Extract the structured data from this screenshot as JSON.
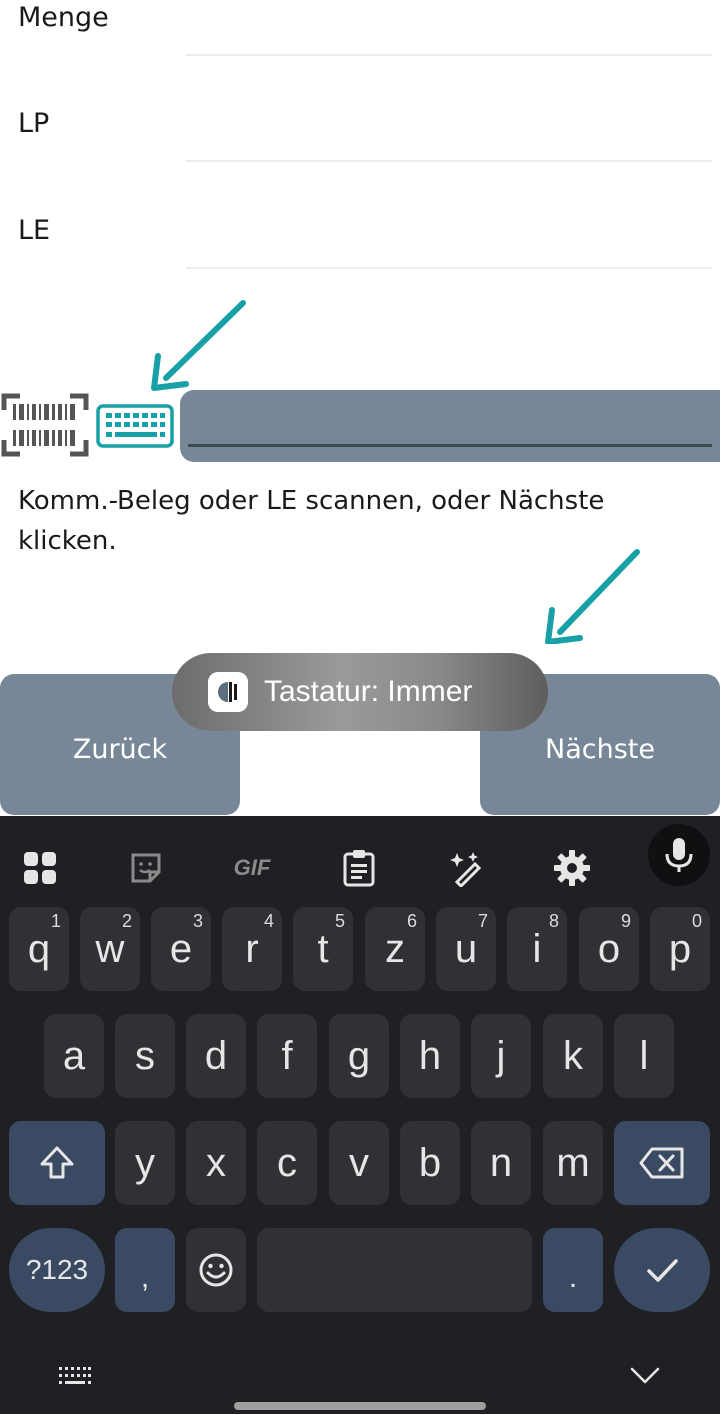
{
  "form": {
    "fields": [
      {
        "label": "Menge",
        "value": ""
      },
      {
        "label": "LP",
        "value": ""
      },
      {
        "label": "LE",
        "value": ""
      }
    ],
    "scan_input_value": "",
    "hint": "Komm.-Beleg oder LE scannen, oder Nächste klicken."
  },
  "buttons": {
    "back": "Zurück",
    "next": "Nächste"
  },
  "toast": {
    "text": "Tastatur: Immer"
  },
  "keyboard": {
    "toolbar": [
      "apps-grid-icon",
      "sticker-icon",
      "gif-icon",
      "clipboard-icon",
      "magic-edit-icon",
      "settings-icon",
      "microphone-icon"
    ],
    "gif_label": "GIF",
    "row1": [
      {
        "key": "q",
        "hint": "1"
      },
      {
        "key": "w",
        "hint": "2"
      },
      {
        "key": "e",
        "hint": "3"
      },
      {
        "key": "r",
        "hint": "4"
      },
      {
        "key": "t",
        "hint": "5"
      },
      {
        "key": "z",
        "hint": "6"
      },
      {
        "key": "u",
        "hint": "7"
      },
      {
        "key": "i",
        "hint": "8"
      },
      {
        "key": "o",
        "hint": "9"
      },
      {
        "key": "p",
        "hint": "0"
      }
    ],
    "row2": [
      "a",
      "s",
      "d",
      "f",
      "g",
      "h",
      "j",
      "k",
      "l"
    ],
    "row3": [
      "y",
      "x",
      "c",
      "v",
      "b",
      "n",
      "m"
    ],
    "symbols_label": "?123",
    "comma": ",",
    "period": "."
  },
  "colors": {
    "accent_teal": "#17a0a6",
    "button_gray": "#788797",
    "keyboard_bg": "#1e2023",
    "key_bg": "#2f3134",
    "fn_key_bg": "#3a4a63"
  }
}
